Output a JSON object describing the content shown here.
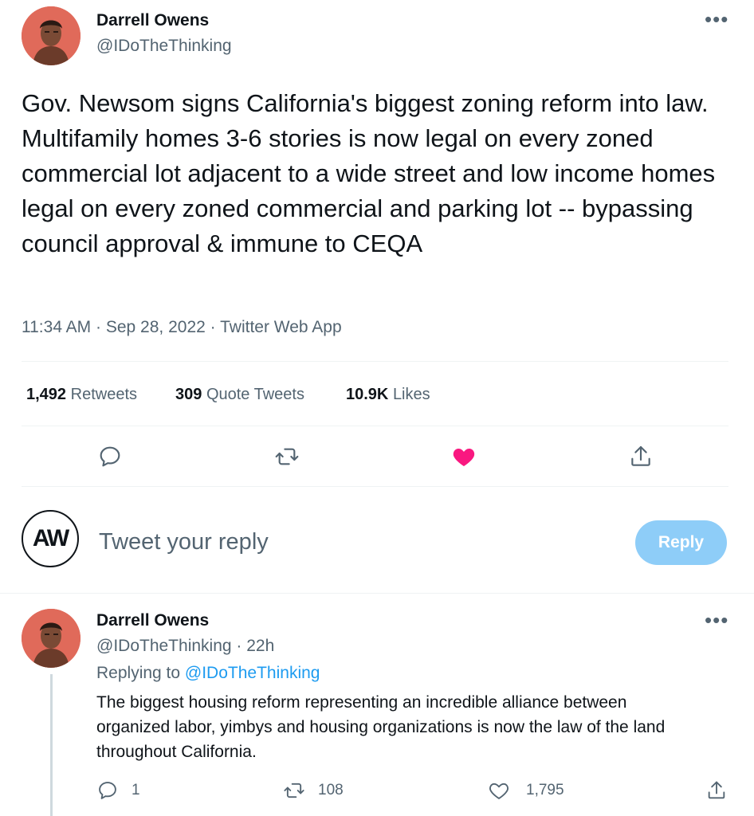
{
  "main_tweet": {
    "author_name": "Darrell Owens",
    "author_handle": "@IDoTheThinking",
    "more": "•••",
    "text": "Gov. Newsom signs California's biggest zoning reform into law. Multifamily homes 3-6 stories is now legal on every zoned commercial lot adjacent to a wide street and low income homes legal on every zoned commercial and parking lot -- bypassing council approval & immune to CEQA",
    "time": "11:34 AM",
    "date": "Sep 28, 2022",
    "source": "Twitter Web App",
    "sep": "·"
  },
  "stats": {
    "retweets_count": "1,492",
    "retweets_label": "Retweets",
    "quotes_count": "309",
    "quotes_label": "Quote Tweets",
    "likes_count": "10.9K",
    "likes_label": "Likes"
  },
  "actions": {
    "reply_icon": "reply-icon",
    "retweet_icon": "retweet-icon",
    "like_icon": "heart-filled-icon",
    "share_icon": "share-icon",
    "liked_color": "#f91880"
  },
  "compose": {
    "avatar_text": "AW",
    "placeholder": "Tweet your reply",
    "reply_button": "Reply",
    "button_color": "#8ecdf8"
  },
  "reply_tweet": {
    "author_name": "Darrell Owens",
    "author_handle": "@IDoTheThinking",
    "sep": "·",
    "age": "22h",
    "more": "•••",
    "replying_prefix": "Replying to",
    "replying_to": "@IDoTheThinking",
    "text": "The biggest housing reform representing an incredible alliance between organized labor, yimbys and housing organizations is now the law of the land throughout California.",
    "reply_count": "1",
    "retweet_count": "108",
    "like_count": "1,795"
  },
  "colors": {
    "text": "#0f1419",
    "secondary": "#536471",
    "link": "#1d9bf0",
    "avatar_bg": "#e06a5a"
  }
}
